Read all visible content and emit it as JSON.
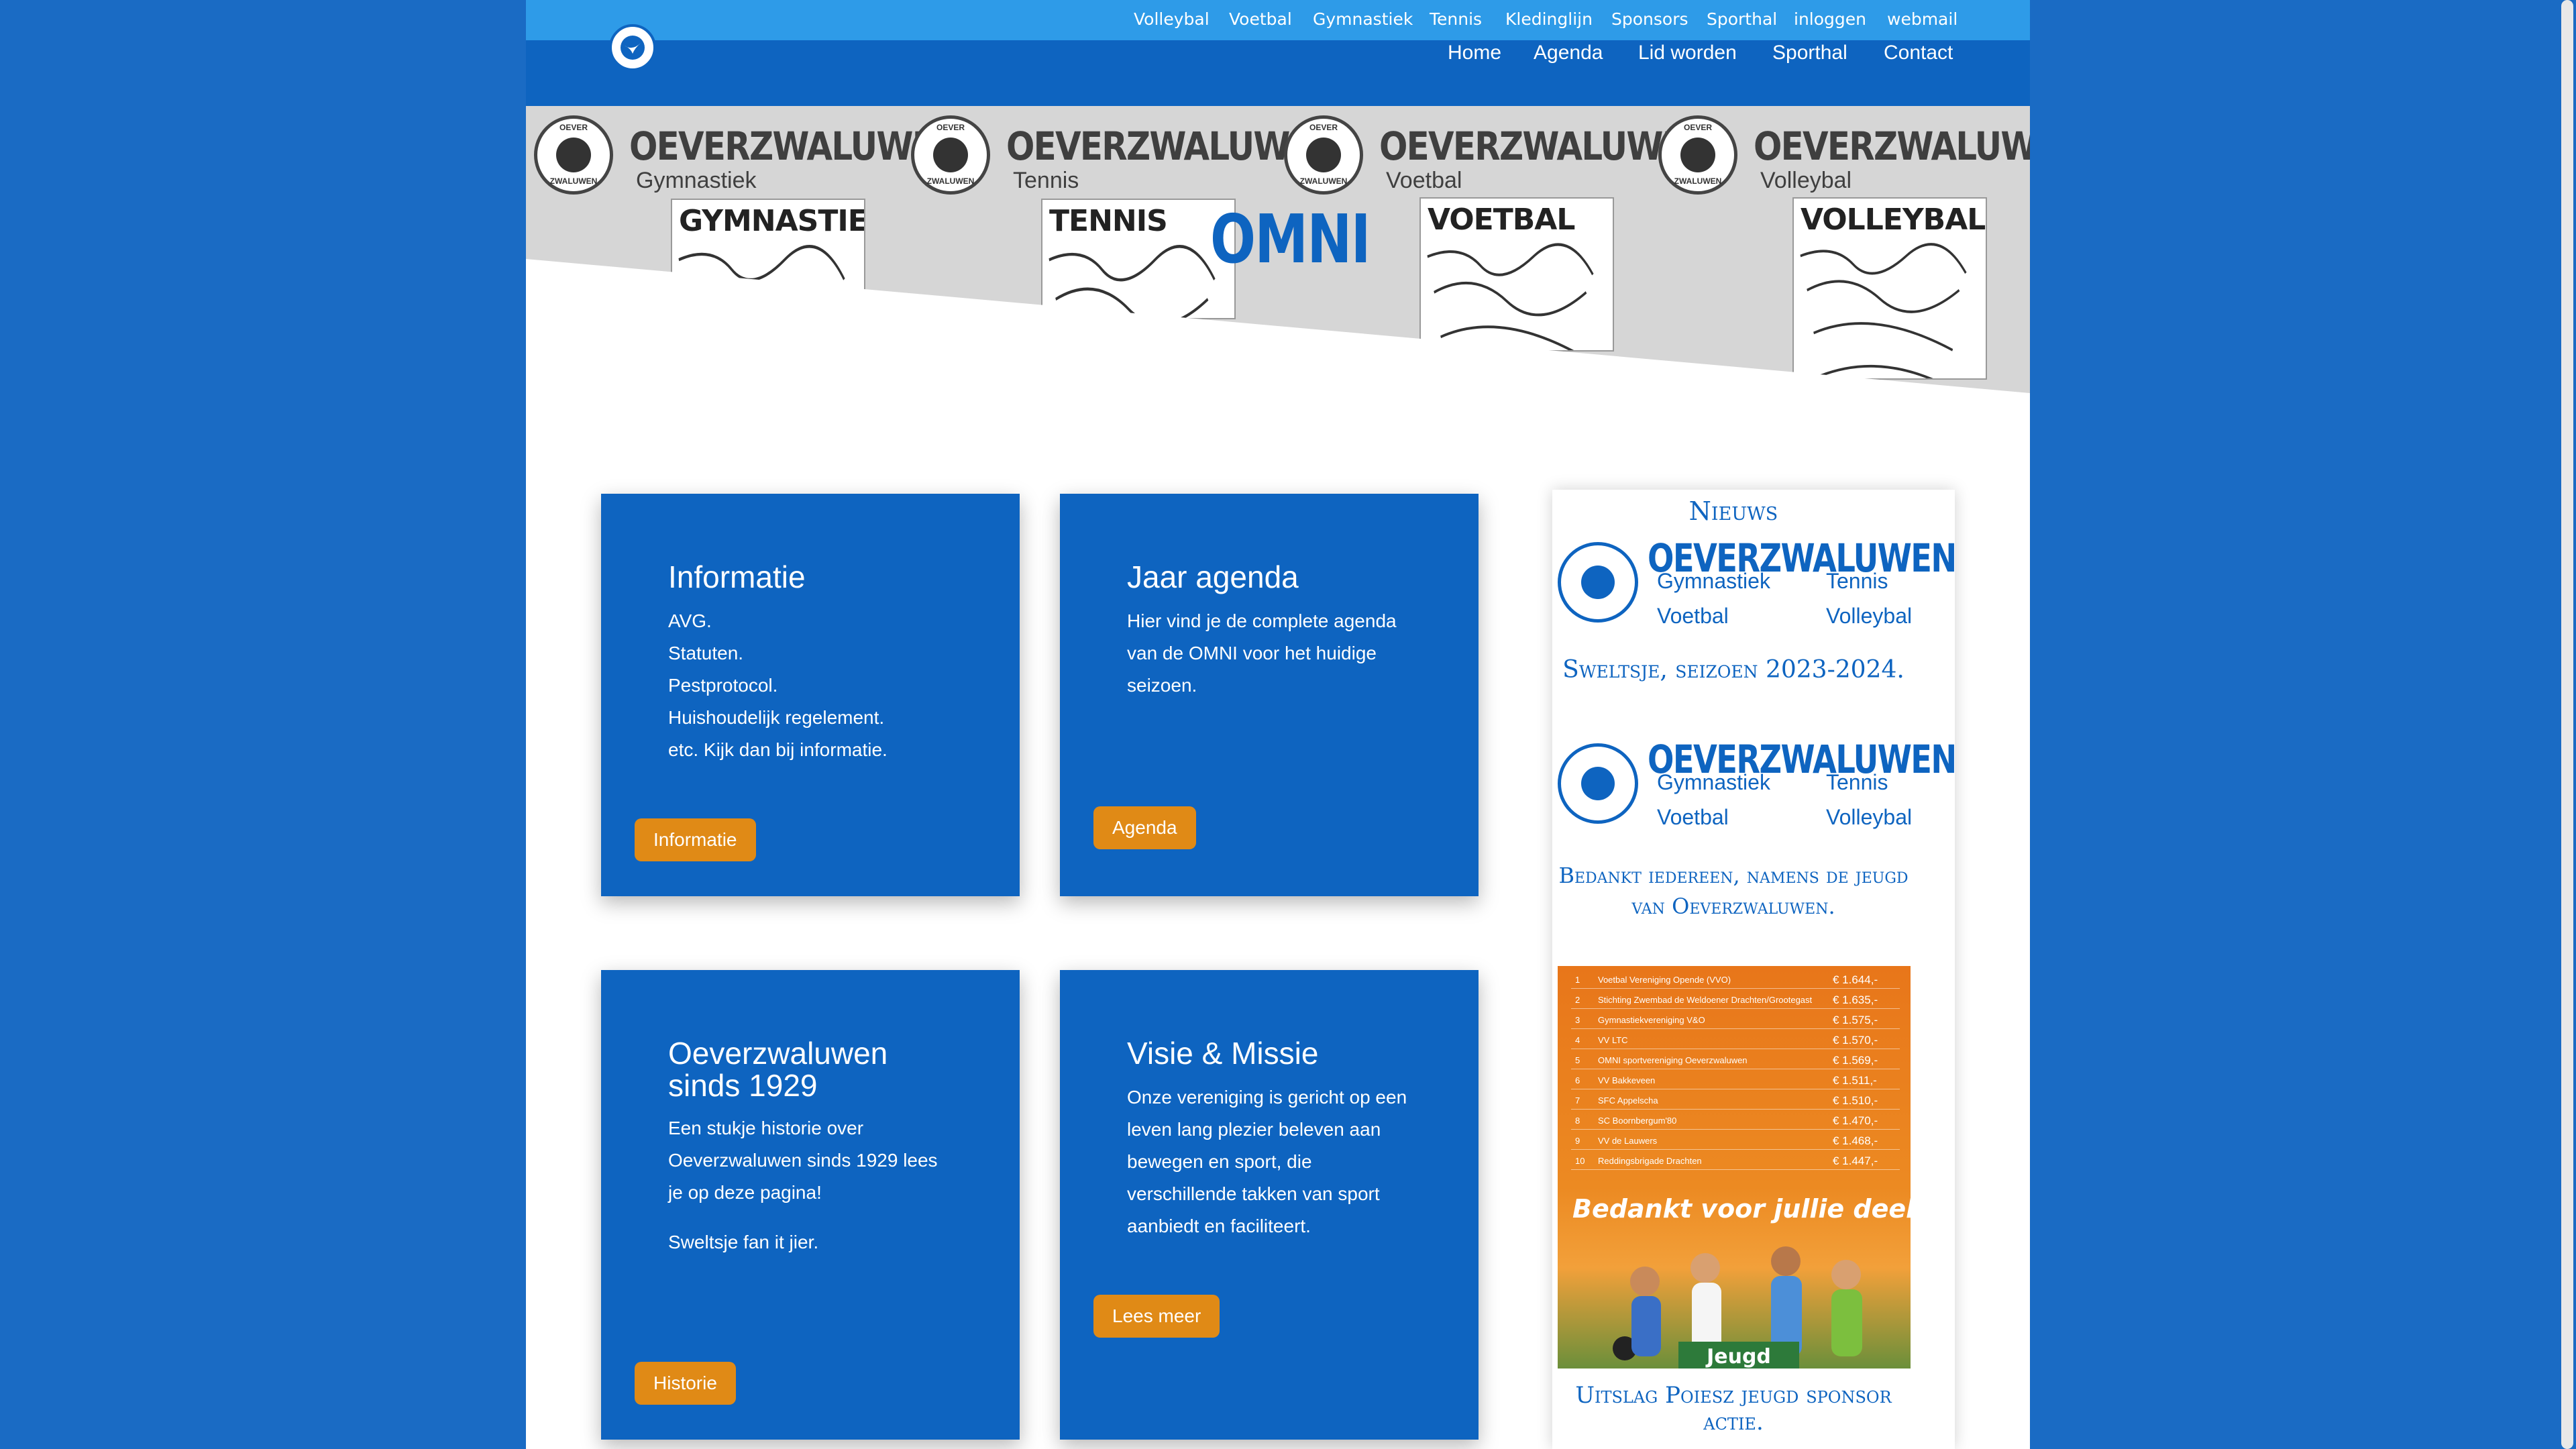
{
  "topnav": [
    "Volleybal",
    "Voetbal",
    "Gymnastiek",
    "Tennis",
    "Kledinglijn",
    "Sponsors",
    "Sporthal",
    "inloggen",
    "webmail"
  ],
  "mainnav": [
    "Home",
    "Agenda",
    "Lid worden",
    "Sporthal",
    "Contact"
  ],
  "hero": {
    "brand_name": "OEVERZWALUWEN",
    "seal_top": "OEVER",
    "seal_bottom": "ZWALUWEN",
    "sports": [
      "Gymnastiek",
      "Tennis",
      "Voetbal",
      "Volleybal"
    ],
    "sketch_titles": [
      "GYMNASTIEK",
      "TENNIS",
      "VOETBAL",
      "VOLLEYBAL"
    ],
    "title": "OMNI"
  },
  "cards": [
    {
      "title": "Informatie",
      "lines": [
        "AVG.",
        "Statuten.",
        "Pestprotocol.",
        "Huishoudelijk regelement.",
        "etc. Kijk dan bij informatie."
      ],
      "button": "Informatie"
    },
    {
      "title": "Jaar agenda",
      "lines": [
        "Hier vind je de complete agenda",
        "van de OMNI voor het huidige",
        "seizoen."
      ],
      "button": "Agenda"
    },
    {
      "title": "Oeverzwaluwen sinds 1929",
      "title_lines": [
        "Oeverzwaluwen",
        "sinds 1929"
      ],
      "lines": [
        "Een stukje historie over",
        "Oeverzwaluwen sinds 1929 lees",
        "je op deze pagina!"
      ],
      "extra": "Sweltsje fan it jier.",
      "button": "Historie"
    },
    {
      "title": "Visie & Missie",
      "lines": [
        "Onze vereniging is gericht op een",
        "leven lang plezier beleven aan",
        "bewegen en sport, die",
        "verschillende takken van sport",
        "aanbiedt en faciliteert."
      ],
      "button": "Lees meer"
    }
  ],
  "sidebar": {
    "heading": "Nieuws",
    "logo_sports": [
      "Gymnastiek",
      "Tennis",
      "Voetbal",
      "Volleybal"
    ],
    "item1": "Sweltsje, seizoen 2023-2024.",
    "item2_line1": "Bedankt iedereen, namens de jeugd",
    "item2_line2": "van Oeverzwaluwen.",
    "item3": "Uitslag Poiesz jeugd sponsor actie."
  },
  "ranking": {
    "rows": [
      {
        "n": "1",
        "name": "Voetbal Vereniging Opende (VVO)",
        "amount": "€ 1.644,-"
      },
      {
        "n": "2",
        "name": "Stichting Zwembad de Weldoener Drachten/Grootegast",
        "amount": "€ 1.635,-"
      },
      {
        "n": "3",
        "name": "Gymnastiekvereniging V&O",
        "amount": "€ 1.575,-"
      },
      {
        "n": "4",
        "name": "VV LTC",
        "amount": "€ 1.570,-"
      },
      {
        "n": "5",
        "name": "OMNI sportvereniging Oeverzwaluwen",
        "amount": "€ 1.569,-"
      },
      {
        "n": "6",
        "name": "VV Bakkeveen",
        "amount": "€ 1.511,-"
      },
      {
        "n": "7",
        "name": "SFC Appelscha",
        "amount": "€ 1.510,-"
      },
      {
        "n": "8",
        "name": "SC Boornbergum'80",
        "amount": "€ 1.470,-"
      },
      {
        "n": "9",
        "name": "VV de Lauwers",
        "amount": "€ 1.468,-"
      },
      {
        "n": "10",
        "name": "Reddingsbrigade Drachten",
        "amount": "€ 1.447,-"
      }
    ],
    "thanks": "Bedankt voor jullie deelname!",
    "brand": "Jeugd"
  },
  "colors": {
    "page_bg": "#1a6bc4",
    "topbar": "#2e9be8",
    "mainbar": "#0e64c0",
    "card": "#0e64c0",
    "button": "#e08a16",
    "hero_bg": "#d6d6d6"
  }
}
